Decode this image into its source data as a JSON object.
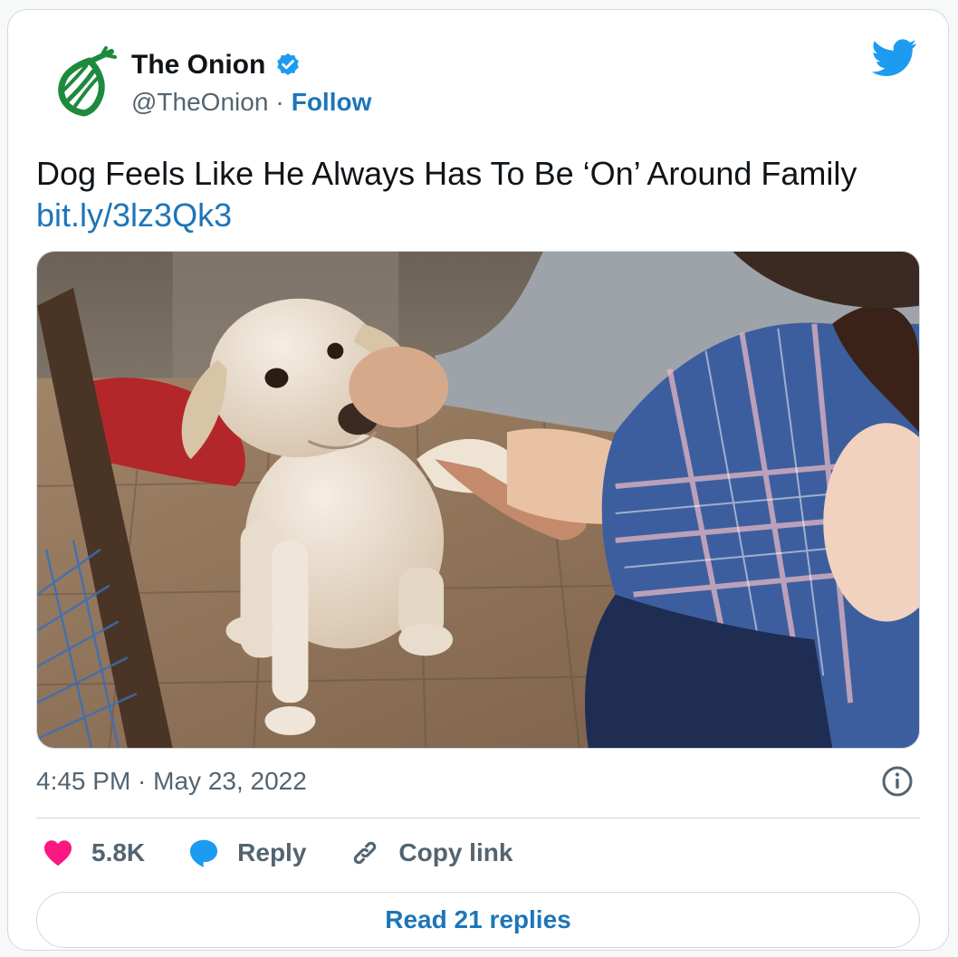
{
  "account": {
    "display_name": "The Onion",
    "handle": "@TheOnion",
    "separator": "·",
    "follow_label": "Follow"
  },
  "tweet": {
    "text": "Dog Feels Like He Always Has To Be ‘On’ Around Family",
    "link": "bit.ly/3lz3Qk3",
    "timestamp": "4:45 PM · May 23, 2022"
  },
  "actions": {
    "like_count": "5.8K",
    "reply_label": "Reply",
    "copy_link_label": "Copy link"
  },
  "footer": {
    "read_replies_label": "Read 21 replies"
  },
  "icons": {
    "avatar": "onion-logo-icon",
    "verified": "verified-badge-icon",
    "brand": "twitter-bird-icon",
    "info": "info-icon",
    "like": "heart-icon",
    "reply": "speech-bubble-icon",
    "copy_link": "link-icon"
  },
  "colors": {
    "accent": "#1d75b8",
    "like": "#f91880",
    "brand_green": "#1d8a3e",
    "twitter_blue": "#1d9bf0",
    "secondary_text": "#536471",
    "primary_text": "#0f1419"
  }
}
